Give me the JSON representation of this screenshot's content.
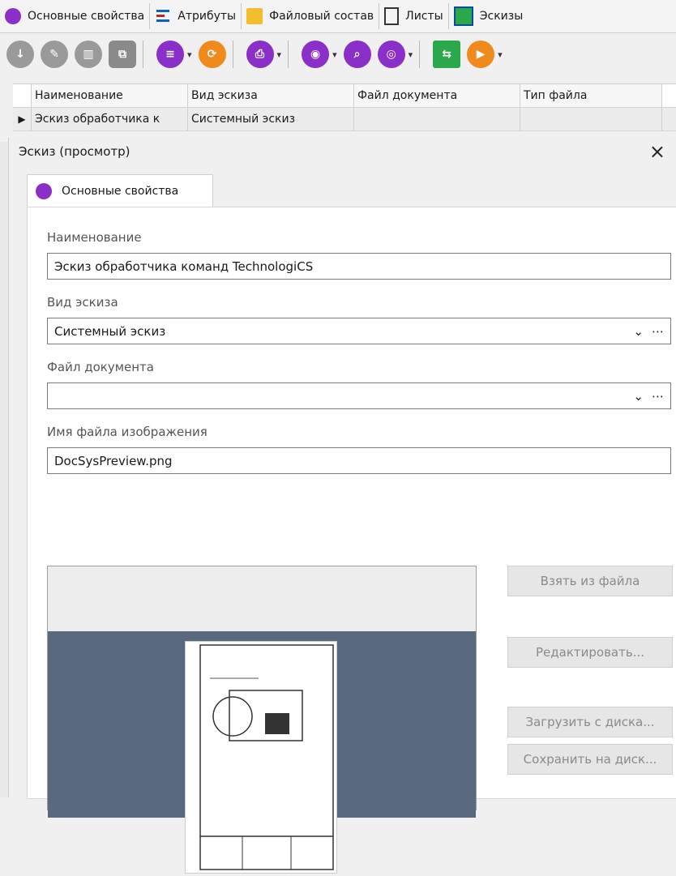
{
  "tabs": [
    {
      "label": "Основные свойства",
      "icon": "purple-circle-icon"
    },
    {
      "label": "Атрибуты",
      "icon": "attributes-icon"
    },
    {
      "label": "Файловый состав",
      "icon": "files-icon"
    },
    {
      "label": "Листы",
      "icon": "sheet-icon"
    },
    {
      "label": "Эскизы",
      "icon": "sketch-icon"
    }
  ],
  "toolbar": {
    "icons": [
      "download-icon",
      "edit-icon",
      "delete-icon",
      "paste-icon",
      "document-icon",
      "refresh-icon",
      "print-icon",
      "view-icon",
      "search-icon",
      "globe-icon",
      "export-icon",
      "play-icon"
    ]
  },
  "grid": {
    "headers": [
      "Наименование",
      "Вид эскиза",
      "Файл документа",
      "Тип файла"
    ],
    "rows": [
      [
        "Эскиз обработчика к",
        "Системный эскиз",
        "",
        ""
      ]
    ]
  },
  "dialog": {
    "title": "Эскиз (просмотр)",
    "tab": "Основные свойства",
    "fields": {
      "name_label": "Наименование",
      "name_value": "Эскиз обработчика команд TechnologiCS",
      "type_label": "Вид эскиза",
      "type_value": "Системный эскиз",
      "doc_label": "Файл документа",
      "doc_value": "",
      "img_label": "Имя файла изображения",
      "img_value": "DocSysPreview.png"
    },
    "buttons": {
      "take_from_file": "Взять из файла",
      "edit": "Редактировать...",
      "load_from_disk": "Загрузить с диска...",
      "save_to_disk": "Сохранить на диск..."
    }
  }
}
